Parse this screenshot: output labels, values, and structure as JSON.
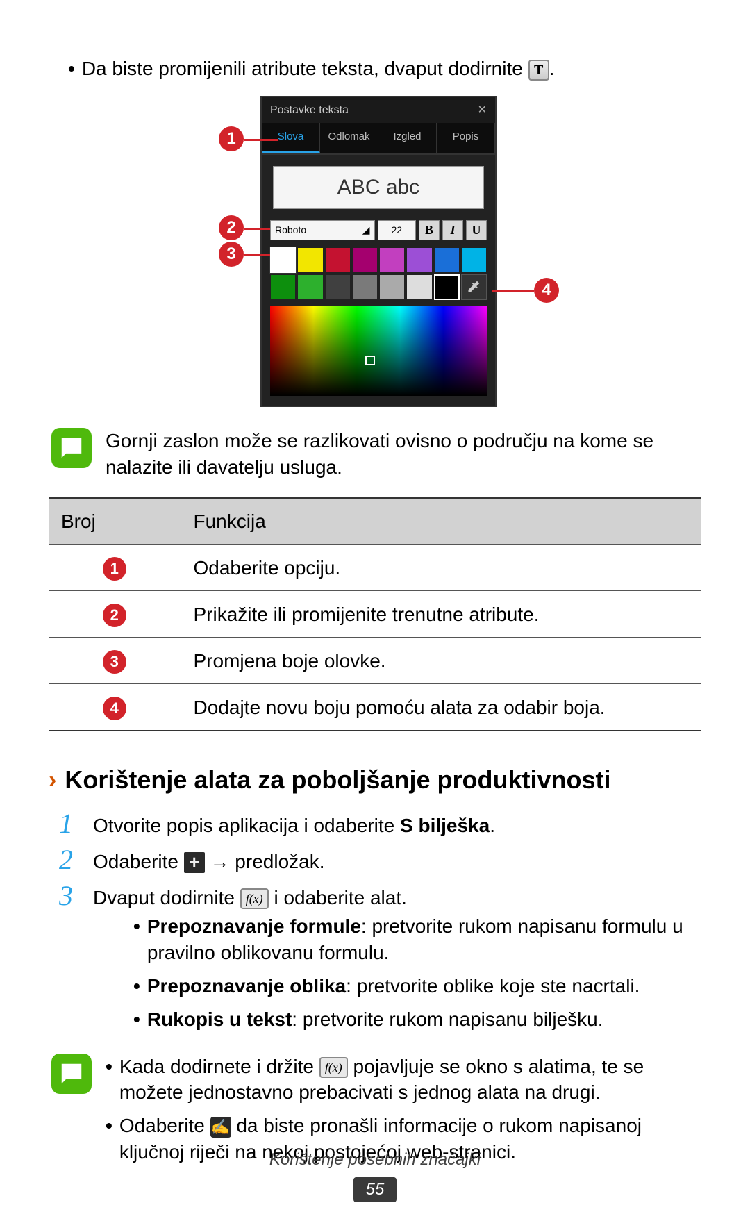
{
  "top_bullet": {
    "text_before": "Da biste promijenili atribute teksta, dvaput dodirnite ",
    "text_after": "."
  },
  "text_icon_glyph": "T",
  "panel": {
    "title": "Postavke teksta",
    "tabs": [
      "Slova",
      "Odlomak",
      "Izgled",
      "Popis"
    ],
    "preview": "ABC abc",
    "font_name": "Roboto",
    "font_size": "22",
    "swatches_row1": [
      "#ffffff",
      "#f2e600",
      "#c41230",
      "#a4006e",
      "#c23fbf",
      "#9c4fd6",
      "#1a6fd8",
      "#00b3e6"
    ],
    "swatches_row2": [
      "#0d8f0d",
      "#2db02d",
      "#404040",
      "#7a7a7a",
      "#aaaaaa",
      "#dddddd",
      "#000000",
      "eyedrop"
    ]
  },
  "note1": "Gornji zaslon može se razlikovati ovisno o području na kome se nalazite ili davatelju usluga.",
  "table": {
    "head_num": "Broj",
    "head_func": "Funkcija",
    "rows": [
      {
        "n": "1",
        "f": "Odaberite opciju."
      },
      {
        "n": "2",
        "f": "Prikažite ili promijenite trenutne atribute."
      },
      {
        "n": "3",
        "f": "Promjena boje olovke."
      },
      {
        "n": "4",
        "f": "Dodajte novu boju pomoću alata za odabir boja."
      }
    ]
  },
  "section_title": "Korištenje alata za poboljšanje produktivnosti",
  "steps": {
    "s1_a": "Otvorite popis aplikacija i odaberite ",
    "s1_bold": "S bilješka",
    "s1_b": ".",
    "s2_a": "Odaberite ",
    "s2_b": " → predložak.",
    "s3_a": "Dvaput dodirnite ",
    "s3_b": " i odaberite alat."
  },
  "sub": {
    "i1_bold": "Prepoznavanje formule",
    "i1_rest": ": pretvorite rukom napisanu formulu u pravilno oblikovanu formulu.",
    "i2_bold": "Prepoznavanje oblika",
    "i2_rest": ": pretvorite oblike koje ste nacrtali.",
    "i3_bold": "Rukopis u tekst",
    "i3_rest": ": pretvorite rukom napisanu bilješku."
  },
  "note2": {
    "b1_a": "Kada dodirnete i držite ",
    "b1_b": " pojavljuje se okno s alatima, te se možete jednostavno prebacivati s jednog alata na drugi.",
    "b2_a": "Odaberite ",
    "b2_b": " da biste pronašli informacije o rukom napisanoj ključnoj riječi na nekoj postojećoj web-stranici."
  },
  "footer_caption": "Korištenje posebnih značajki",
  "page_number": "55",
  "plus_glyph": "+",
  "fx_glyph": "f(x)",
  "search_glyph": "✍"
}
